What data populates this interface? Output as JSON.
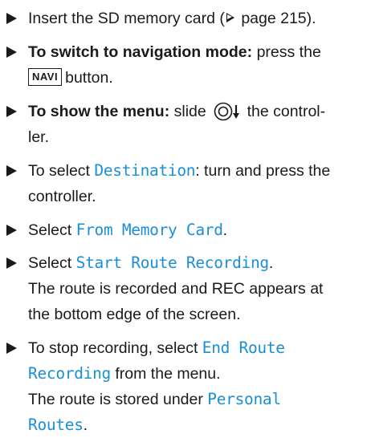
{
  "steps": [
    {
      "pre": "Insert the SD memory card (",
      "ref_icon": "reference-triangle-icon",
      "post": " page 215)."
    },
    {
      "bold": "To switch to navigation mode:",
      "text": " press the",
      "key": "NAVI",
      "after": "button."
    },
    {
      "bold": "To show the menu:",
      "text_a": " slide ",
      "icon": "controller-slide-down-icon",
      "text_b": " the control-",
      "line2": "ler."
    },
    {
      "pre": "To select ",
      "menu": "Destination",
      "post": ": turn and press the",
      "line2": "controller."
    },
    {
      "pre": "Select ",
      "menu": "From Memory Card",
      "post": "."
    },
    {
      "pre": "Select ",
      "menu": "Start Route Recording",
      "post": ".",
      "result_line1": "The route is recorded and REC appears at",
      "result_line2": "the bottom edge of the screen."
    },
    {
      "pre": "To stop recording, select ",
      "menu1": "End Route",
      "menu2": "Recording",
      "post": " from the menu.",
      "result_pre": "The route is stored under ",
      "result_menu1": "Personal",
      "result_menu2": "Routes",
      "result_post": "."
    }
  ],
  "colors": {
    "menu_text": "#1a8fd6",
    "body_text": "#1a1a1a"
  }
}
